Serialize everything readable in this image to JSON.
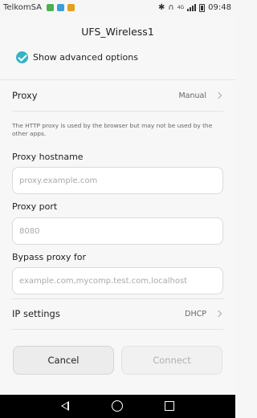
{
  "status_bar": {
    "carrier": "TelkomSA",
    "network_type": "4G",
    "time": "09:48",
    "icons": [
      "sim-icon",
      "photo-icon",
      "download-icon",
      "bluetooth-icon",
      "headphones-icon",
      "signal-icon",
      "battery-icon"
    ]
  },
  "dialog": {
    "title": "UFS_Wireless1",
    "show_advanced": {
      "label": "Show advanced options",
      "checked": true
    },
    "proxy": {
      "label": "Proxy",
      "value": "Manual"
    },
    "helper_text": "The HTTP proxy is used by the browser but may not be used by the other apps.",
    "hostname": {
      "label": "Proxy hostname",
      "value": "",
      "placeholder": "proxy.example.com"
    },
    "port": {
      "label": "Proxy port",
      "value": "",
      "placeholder": "8080"
    },
    "bypass": {
      "label": "Bypass proxy for",
      "value": "",
      "placeholder": "example.com,mycomp.test.com,localhost"
    },
    "ip_settings": {
      "label": "IP settings",
      "value": "DHCP"
    },
    "buttons": {
      "cancel": "Cancel",
      "connect": "Connect"
    }
  },
  "colors": {
    "accent": "#35b3c4",
    "background": "#f7f7f7",
    "navbar": "#000000"
  }
}
